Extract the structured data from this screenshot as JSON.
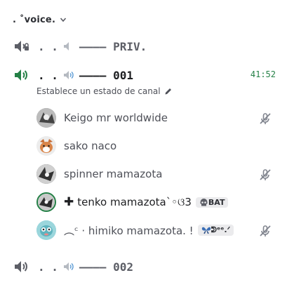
{
  "category": {
    "label": ". ˚voice."
  },
  "channels": [
    {
      "prefix": ". .",
      "name": "‒‒‒‒ PRIV.",
      "state": "locked"
    },
    {
      "prefix": ". .",
      "name": "‒‒‒‒ 001",
      "state": "active",
      "timer": "41:52",
      "status_text": "Establece un estado de canal"
    },
    {
      "prefix": ". .",
      "name": "‒‒‒‒ 002",
      "state": "idle"
    }
  ],
  "users": [
    {
      "name": "Keigo mr worldwide",
      "muted": true
    },
    {
      "name": "sako naco",
      "muted": false
    },
    {
      "name": "spinner mamazota",
      "muted": true
    },
    {
      "name": "tenko mamazota`◦ଓ3",
      "muted": false,
      "prefix": "✚",
      "tag": "BAT",
      "tag_icon": "skull-icon"
    },
    {
      "name": "︵ᶜ  · himiko mamazota. !",
      "muted": true,
      "tag": "ᕲᵉᵉ.ᐟ",
      "tag_icon": "butterfly-icon"
    }
  ],
  "colors": {
    "active_speaker": "#248046",
    "muted_icon": "#80848e",
    "text_dark": "#1e1f22"
  }
}
